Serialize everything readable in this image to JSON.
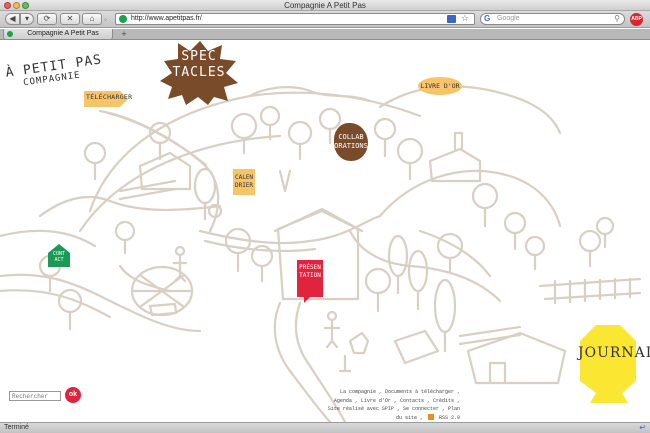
{
  "window": {
    "title": "Compagnie A Petit Pas"
  },
  "toolbar": {
    "back_icon": "back-arrow-icon",
    "forward_icon": "forward-arrow-icon",
    "reload_icon": "reload-icon",
    "stop_icon": "stop-icon",
    "home_icon": "home-icon",
    "url": "http://www.apetitpas.fr/",
    "search_placeholder": "Google",
    "adblock_label": "ABP"
  },
  "tabs": [
    {
      "label": "Compagnie A Petit Pas"
    }
  ],
  "logo": {
    "line1": "À PETIT PAS",
    "line2": "COMPAGNIE"
  },
  "nav": {
    "spectacles": "SPEC TACLES",
    "telecharger": "TÉLÉCHARGER",
    "livre_dor": "LIVRE D'OR",
    "collaborations": "COLLAB ORATIONS",
    "calendrier": "CALEN DRIER",
    "contact": "CONT ACT",
    "presentation": "PRÉSEN TATION",
    "journal": "JOURNAL"
  },
  "search": {
    "placeholder": "Rechercher",
    "button_label": "ok"
  },
  "footer": {
    "line1a": "La compagnie",
    "line1b": "Documents à télécharger",
    "line2a": "Agenda",
    "line2b": "Livre d'Or",
    "line2c": "Contacts",
    "line2d": "Crédits",
    "line3a": "Site réalisé avec SPIP",
    "line3b": "Se connecter",
    "line3c": "Plan",
    "line4a": "du site",
    "line4b": "RSS 2.0"
  },
  "status": {
    "text": "Terminé"
  },
  "colors": {
    "brown": "#7a4b2a",
    "yellow": "#f7c46a",
    "journal_yellow": "#fbe632",
    "green": "#1a9a55",
    "crimson": "#e2233d",
    "line": "#d9cfc3"
  }
}
